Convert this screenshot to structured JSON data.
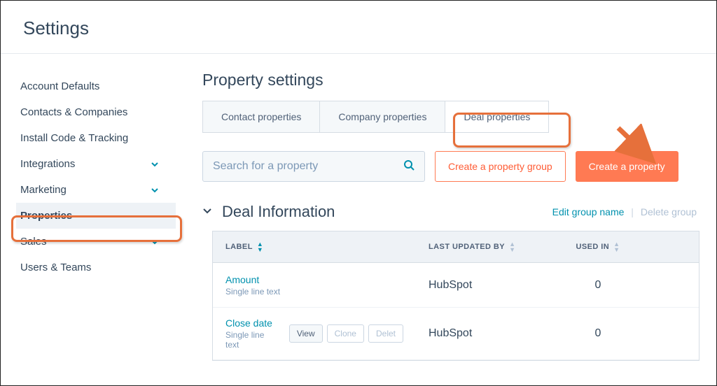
{
  "header": {
    "title": "Settings"
  },
  "sidebar": {
    "items": [
      {
        "label": "Account Defaults",
        "expandable": false
      },
      {
        "label": "Contacts & Companies",
        "expandable": false
      },
      {
        "label": "Install Code & Tracking",
        "expandable": false
      },
      {
        "label": "Integrations",
        "expandable": true
      },
      {
        "label": "Marketing",
        "expandable": true
      },
      {
        "label": "Properties",
        "expandable": false,
        "active": true
      },
      {
        "label": "Sales",
        "expandable": true
      },
      {
        "label": "Users & Teams",
        "expandable": false
      }
    ]
  },
  "main": {
    "heading": "Property settings",
    "tabs": [
      {
        "label": "Contact properties"
      },
      {
        "label": "Company properties"
      },
      {
        "label": "Deal properties",
        "active": true
      }
    ],
    "search": {
      "placeholder": "Search for a property"
    },
    "buttons": {
      "create_group": "Create a property group",
      "create_property": "Create a property"
    },
    "group": {
      "title": "Deal Information",
      "edit_label": "Edit group name",
      "delete_label": "Delete group"
    },
    "table": {
      "columns": {
        "label": "LABEL",
        "updated_by": "LAST UPDATED BY",
        "used_in": "USED IN"
      },
      "rows": [
        {
          "name": "Amount",
          "type": "Single line text",
          "updated_by": "HubSpot",
          "used_in": "0"
        },
        {
          "name": "Close date",
          "type": "Single line text",
          "updated_by": "HubSpot",
          "used_in": "0",
          "actions": {
            "view": "View",
            "clone": "Clone",
            "delete": "Delet"
          }
        }
      ]
    }
  },
  "colors": {
    "accent": "#ff7a53",
    "link": "#0091ae"
  }
}
